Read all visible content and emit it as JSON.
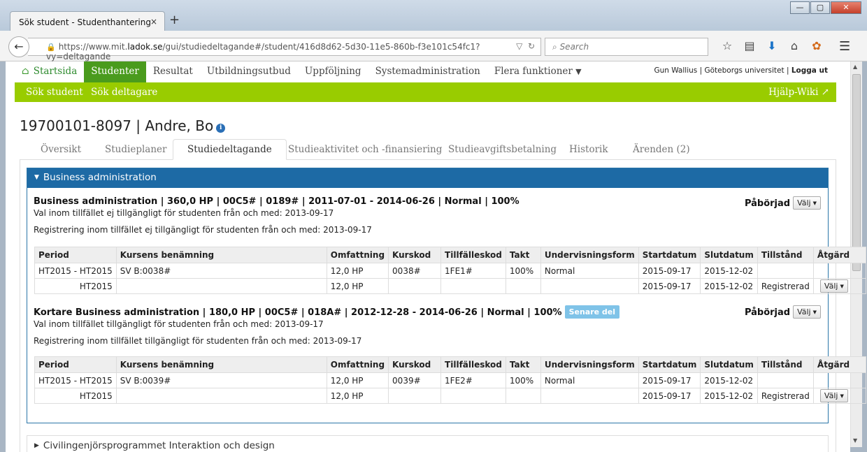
{
  "browser": {
    "tab_title": "Sök student - Studenthantering",
    "tab_close": "×",
    "new_tab": "+",
    "window_buttons": [
      "—",
      "▢",
      "✕"
    ],
    "url_prefix": "https://www.mit.",
    "url_domain": "ladok.se",
    "url_path": "/gui/studiedeltagande#/student/416d8d62-5d30-11e5-860b-f3e101c54fc1?vy=deltagande",
    "search_placeholder": "Search"
  },
  "app": {
    "nav": {
      "home": "Startsida",
      "studenter": "Studenter",
      "resultat": "Resultat",
      "utbildningsutbud": "Utbildningsutbud",
      "uppfoljning": "Uppföljning",
      "systemadmin": "Systemadministration",
      "flera": "Flera funktioner"
    },
    "user": {
      "name": "Gun Wallius",
      "org": "Göteborgs universitet",
      "logout": "Logga ut"
    },
    "subnav": {
      "sok_student": "Sök student",
      "sok_deltagare": "Sök deltagare",
      "help": "Hjälp-Wiki"
    }
  },
  "page": {
    "title": "19700101-8097 | Andre, Bo",
    "tabs": [
      "Översikt",
      "Studieplaner",
      "Studiedeltagande",
      "Studieaktivitet och -finansiering",
      "Studieavgiftsbetalning",
      "Historik",
      "Ärenden (2)"
    ],
    "active_tab": "Studiedeltagande"
  },
  "panel": {
    "title": "Business administration",
    "next_panel_title": "Civilingenjörsprogrammet Interaktion och design",
    "columns": [
      "Period",
      "Kursens benämning",
      "Omfattning",
      "Kurskod",
      "Tillfälleskod",
      "Takt",
      "Undervisningsform",
      "Startdatum",
      "Slutdatum",
      "Tillstånd",
      "Åtgärd"
    ],
    "valj_label": "Välj",
    "courses": [
      {
        "title": "Business administration | 360,0 HP | 00C5# | 0189# | 2011-07-01 - 2014-06-26 | Normal | 100%",
        "badge": "",
        "line1": "Val inom tillfället ej tillgängligt för studenten från och med: 2013-09-17",
        "line2": "Registrering inom tillfället ej tillgängligt för studenten från och med: 2013-09-17",
        "status": "Påbörjad",
        "rows": [
          [
            "HT2015 - HT2015",
            "SV B:0038#",
            "12,0 HP",
            "0038#",
            "1FE1#",
            "100%",
            "Normal",
            "2015-09-17",
            "2015-12-02",
            "",
            ""
          ],
          [
            "HT2015",
            "",
            "12,0 HP",
            "",
            "",
            "",
            "",
            "2015-09-17",
            "2015-12-02",
            "Registrerad",
            "Välj"
          ]
        ]
      },
      {
        "title": "Kortare Business administration | 180,0 HP | 00C5# | 018A# | 2012-12-28 - 2014-06-26 | Normal | 100%",
        "badge": "Senare del",
        "line1": "Val inom tillfället tillgängligt för studenten från och med: 2013-09-17",
        "line2": "Registrering inom tillfället tillgängligt för studenten från och med: 2013-09-17",
        "status": "Påbörjad",
        "rows": [
          [
            "HT2015 - HT2015",
            "SV B:0039#",
            "12,0 HP",
            "0039#",
            "1FE2#",
            "100%",
            "Normal",
            "2015-09-17",
            "2015-12-02",
            "",
            ""
          ],
          [
            "HT2015",
            "",
            "12,0 HP",
            "",
            "",
            "",
            "",
            "2015-09-17",
            "2015-12-02",
            "Registrerad",
            "Välj"
          ]
        ]
      }
    ]
  }
}
